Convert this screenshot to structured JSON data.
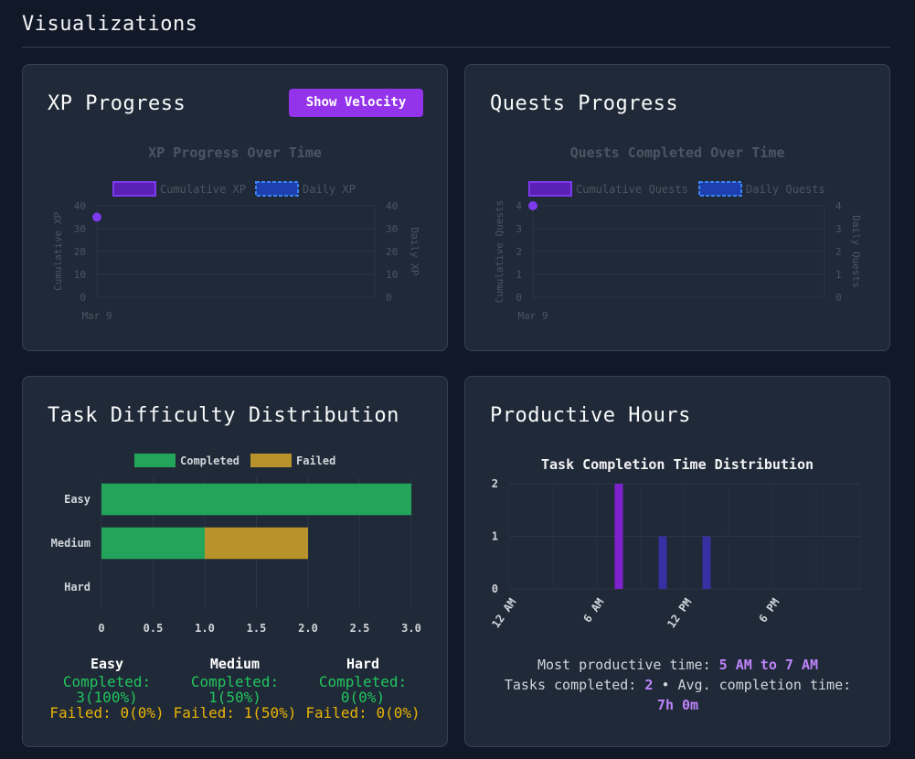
{
  "page": {
    "title": "Visualizations"
  },
  "xp": {
    "title": "XP Progress",
    "button": "Show Velocity",
    "chart_data": {
      "type": "line",
      "title": "XP Progress Over Time",
      "x": [
        "Mar 9"
      ],
      "series": [
        {
          "name": "Cumulative XP",
          "values": [
            35
          ],
          "color": "#7c3aed"
        },
        {
          "name": "Daily XP",
          "values": [],
          "color": "#3b82f6"
        }
      ],
      "ylabel": "Cumulative XP",
      "y2label": "Daily XP",
      "ylim": [
        0,
        40
      ],
      "yticks": [
        "40",
        "30",
        "20",
        "10",
        "0"
      ],
      "y2ticks": [
        "40",
        "30",
        "20",
        "10",
        "0"
      ]
    }
  },
  "quests": {
    "title": "Quests Progress",
    "chart_data": {
      "type": "line",
      "title": "Quests Completed Over Time",
      "x": [
        "Mar 9"
      ],
      "series": [
        {
          "name": "Cumulative Quests",
          "values": [
            4
          ],
          "color": "#7c3aed"
        },
        {
          "name": "Daily Quests",
          "values": [],
          "color": "#3b82f6"
        }
      ],
      "ylabel": "Cumulative Quests",
      "y2label": "Daily Quests",
      "ylim": [
        0,
        4
      ],
      "yticks": [
        "4",
        "3",
        "2",
        "1",
        "0"
      ],
      "y2ticks": [
        "4",
        "3",
        "2",
        "1",
        "0"
      ]
    }
  },
  "difficulty": {
    "title": "Task Difficulty Distribution",
    "chart_data": {
      "type": "bar",
      "orientation": "horizontal",
      "stacked": true,
      "categories": [
        "Easy",
        "Medium",
        "Hard"
      ],
      "series": [
        {
          "name": "Completed",
          "values": [
            3,
            1,
            0
          ],
          "color": "#22a55a"
        },
        {
          "name": "Failed",
          "values": [
            0,
            1,
            0
          ],
          "color": "#b8922a"
        }
      ],
      "xlim": [
        0,
        3
      ],
      "xticks": [
        "0",
        "0.5",
        "1.0",
        "1.5",
        "2.0",
        "2.5",
        "3.0"
      ]
    },
    "stats": [
      {
        "name": "Easy",
        "completed": "Completed:",
        "completed_val": "3(100%)",
        "failed": "Failed: 0(0%)"
      },
      {
        "name": "Medium",
        "completed": "Completed:",
        "completed_val": "1(50%)",
        "failed": "Failed: 1(50%)"
      },
      {
        "name": "Hard",
        "completed": "Completed: 0(0%)",
        "completed_val": "",
        "failed": "Failed: 0(0%)"
      }
    ]
  },
  "hours": {
    "title": "Productive Hours",
    "chart_data": {
      "type": "bar",
      "title": "Task Completion Time Distribution",
      "hours": [
        7,
        10,
        13
      ],
      "values": [
        2,
        1,
        1
      ],
      "colors": [
        "#7e22ce",
        "#3730a3",
        "#3730a3"
      ],
      "ylim": [
        0,
        2
      ],
      "yticks": [
        "2",
        "1",
        "0"
      ],
      "xticks": [
        "12 AM",
        "6 AM",
        "12 PM",
        "6 PM"
      ]
    },
    "line1_prefix": "Most productive time:",
    "line1_value": "5 AM to 7 AM",
    "line2_prefix": "Tasks completed:",
    "line2_count": "2",
    "line2_mid": "• Avg. completion time:",
    "line3_value": "7h 0m"
  }
}
